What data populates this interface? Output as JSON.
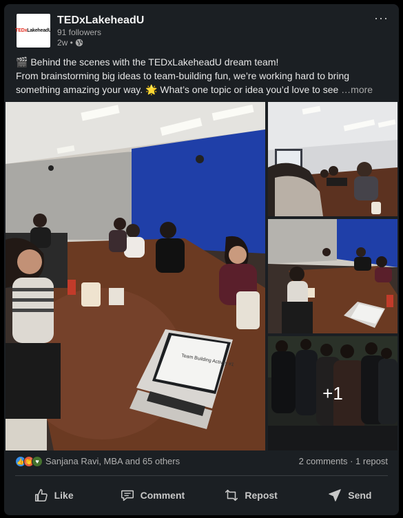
{
  "post": {
    "org_name": "TEDxLakeheadU",
    "logo_text": "TEDx",
    "logo_suffix": "LakeheadU",
    "followers": "91 followers",
    "time": "2w •",
    "menu": "···",
    "text_line1": "🎬 Behind the scenes with the TEDxLakeheadU dream team!",
    "text_line2": "From brainstorming big ideas to team-building fun, we’re working hard to bring",
    "text_line3": "something amazing your way. 🌟 What’s one topic or idea you’d love to see ",
    "see_more": "…more"
  },
  "photos": {
    "laptop_screen_text": "Team Building Activity #1",
    "extra_count": "+1"
  },
  "social": {
    "reactions_text": "Sanjana Ravi, MBA and 65 others",
    "counts_text": "2 comments · 1 repost",
    "reaction_icons": [
      "like-icon",
      "celebrate-icon",
      "support-icon"
    ]
  },
  "actions": {
    "like": "Like",
    "comment": "Comment",
    "repost": "Repost",
    "send": "Send"
  },
  "colors": {
    "card_bg": "#1b1f23",
    "page_bg": "#000000",
    "wall_blue": "#1f3fa8",
    "table_brown": "#6b3a22",
    "ted_red": "#e62b1e"
  }
}
